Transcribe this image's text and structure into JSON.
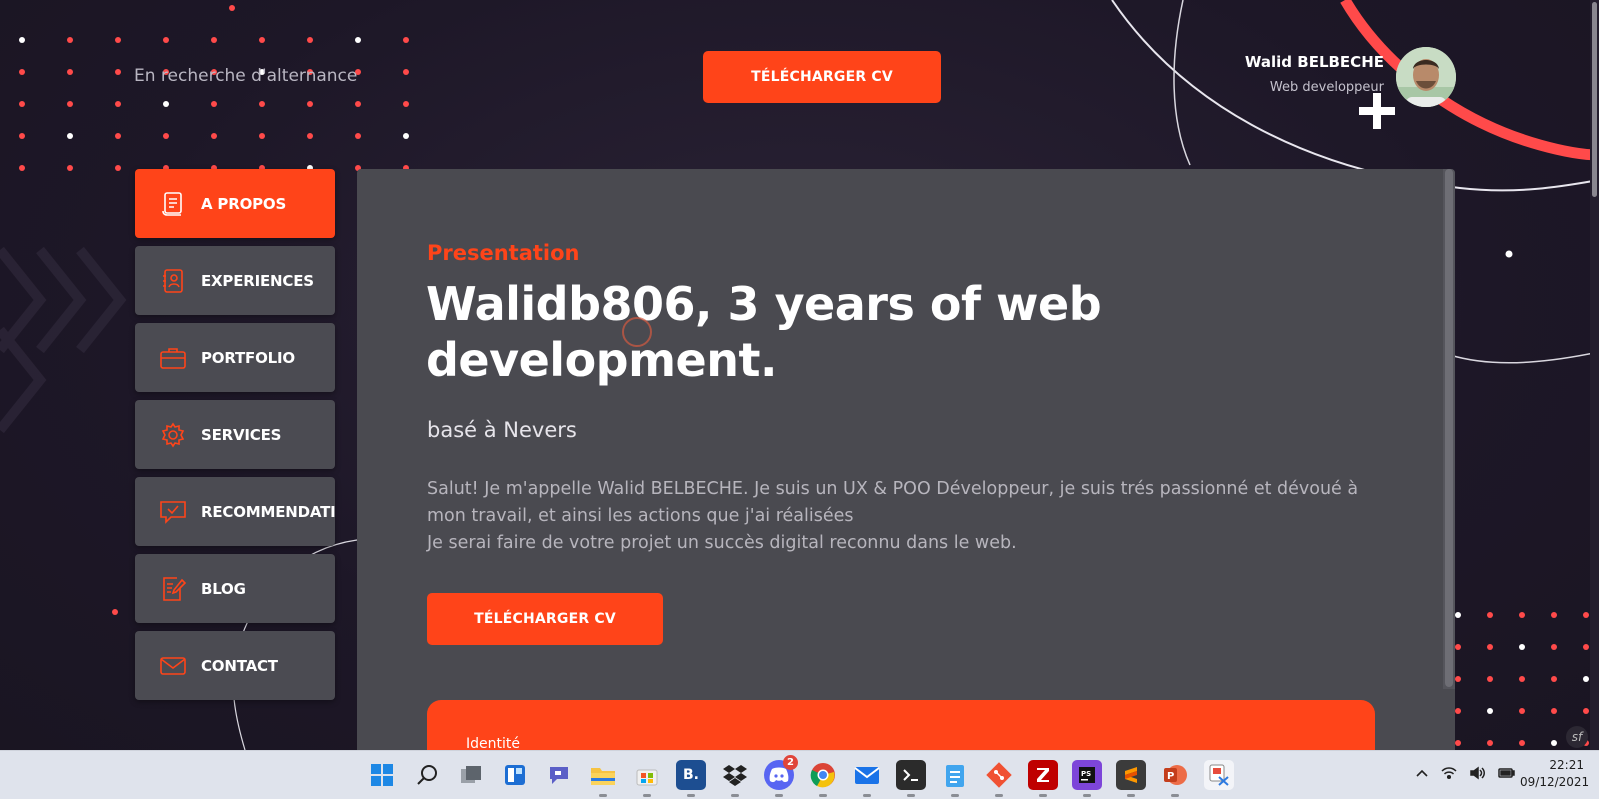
{
  "header": {
    "tagline": "En recherche d'alternance",
    "cv_button_label": "TÉLÉCHARGER CV",
    "profile_name": "Walid BELBECHE",
    "profile_role": "Web developpeur"
  },
  "sidebar": {
    "items": [
      {
        "label": "A PROPOS",
        "icon": "resume-icon",
        "active": true
      },
      {
        "label": "EXPERIENCES",
        "icon": "contact-book-icon",
        "active": false
      },
      {
        "label": "PORTFOLIO",
        "icon": "briefcase-icon",
        "active": false
      },
      {
        "label": "SERVICES",
        "icon": "gear-icon",
        "active": false
      },
      {
        "label": "RECOMMENDATI",
        "icon": "chat-check-icon",
        "active": false
      },
      {
        "label": "BLOG",
        "icon": "edit-document-icon",
        "active": false
      },
      {
        "label": "CONTACT",
        "icon": "envelope-icon",
        "active": false
      }
    ]
  },
  "main": {
    "eyebrow": "Presentation",
    "headline": "Walidb806, 3 years of web development.",
    "location": "basé à Nevers",
    "bio_line1": "Salut! Je m'appelle Walid BELBECHE. Je suis un UX & POO Développeur, je suis trés passionné et dévoué à mon travail, et ainsi les actions que j'ai réalisées",
    "bio_line2": "Je serai faire de votre projet un succès digital reconnu dans le web.",
    "cv_button_label": "TÉLÉCHARGER CV",
    "identity_label": "Identité"
  },
  "taskbar": {
    "apps": [
      "windows-start-icon",
      "search-icon",
      "task-view-icon",
      "widgets-icon",
      "teams-chat-icon",
      "file-explorer-icon",
      "microsoft-store-icon",
      "bootstrap-studio-icon",
      "dropbox-icon",
      "discord-icon",
      "chrome-icon",
      "mail-icon",
      "terminal-icon",
      "notepad-icon",
      "git-icon",
      "filezilla-icon",
      "phpstorm-icon",
      "sublime-text-icon",
      "powerpoint-icon",
      "snipping-tool-icon"
    ],
    "discord_badge": "2",
    "time": "22:21",
    "date": "09/12/2021"
  },
  "colors": {
    "accent": "#ff4419",
    "panel": "#4a4a50",
    "nav_item": "#4b4b52",
    "background": "#1f1a2b"
  }
}
